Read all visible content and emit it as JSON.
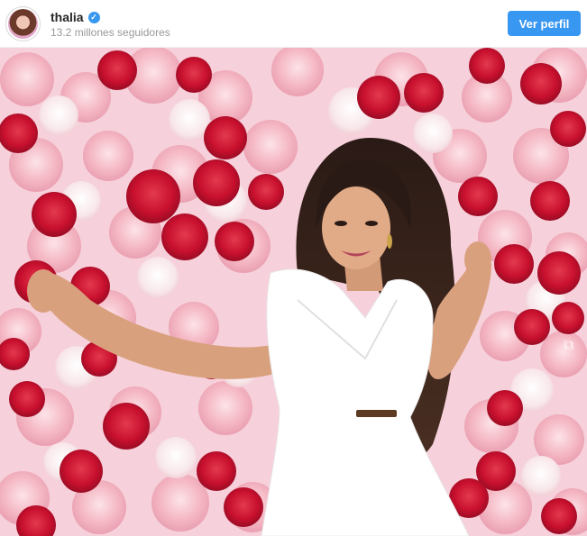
{
  "post": {
    "username": "thalia",
    "followers_text": "13.2 millones seguidores",
    "button_label": "Ver perfil",
    "verified_icon": "check-icon"
  },
  "colors": {
    "button": "#3897f0",
    "verified": "#3897f0",
    "rose_red": "#c8102e",
    "rose_pink": "#f4b6c2",
    "dress": "#ffffff"
  }
}
